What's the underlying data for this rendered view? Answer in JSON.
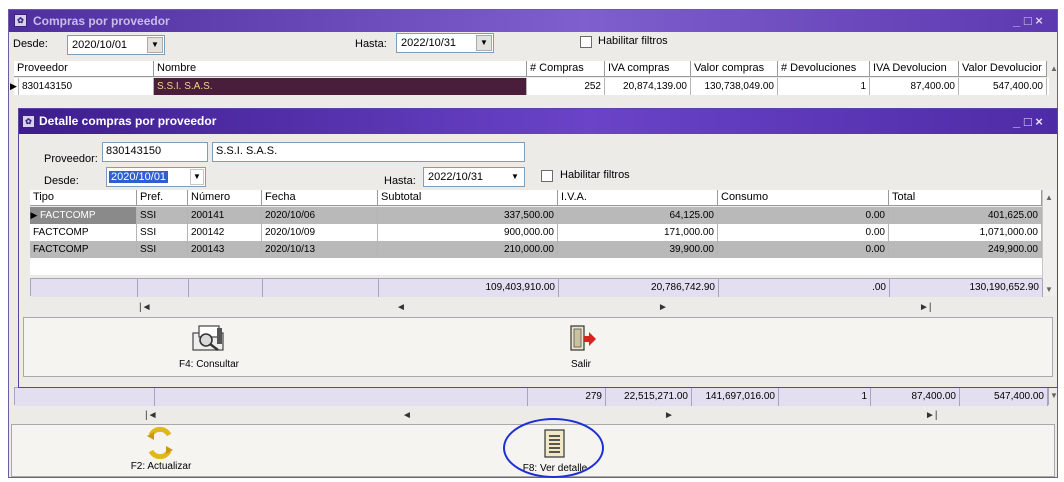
{
  "outer": {
    "title": "Compras por proveedor",
    "window_controls": "_ □ ×",
    "desde_label": "Desde:",
    "desde_value": "2020/10/01",
    "hasta_label": "Hasta:",
    "hasta_value": "2022/10/31",
    "filter_label": "Habilitar filtros",
    "columns": [
      "Proveedor",
      "Nombre",
      "# Compras",
      "IVA compras",
      "Valor compras",
      "# Devoluciones",
      "IVA Devolucion",
      "Valor Devolucior"
    ],
    "row": {
      "proveedor": "830143150",
      "nombre": "S.S.I.  S.A.S.",
      "compras": "252",
      "iva_compras": "20,874,139.00",
      "valor_compras": "130,738,049.00",
      "devoluciones": "1",
      "iva_devolucion": "87,400.00",
      "valor_devolucion": "547,400.00"
    },
    "totals": {
      "compras": "279",
      "iva_compras": "22,515,271.00",
      "valor_compras": "141,697,016.00",
      "devoluciones": "1",
      "iva_devolucion": "87,400.00",
      "valor_devolucion": "547,400.00"
    },
    "btn_actualizar": "F2: Actualizar",
    "btn_ver_detalle": "F8: Ver detalle"
  },
  "detail": {
    "title": "Detalle compras por proveedor",
    "window_controls": "_ □ ×",
    "proveedor_label": "Proveedor:",
    "proveedor_value": "830143150",
    "nombre_value": "S.S.I.  S.A.S.",
    "desde_label": "Desde:",
    "desde_value": "2020/10/01",
    "hasta_label": "Hasta:",
    "hasta_value": "2022/10/31",
    "filter_label": "Habilitar filtros",
    "columns": [
      "Tipo",
      "Pref.",
      "Número",
      "Fecha",
      "Subtotal",
      "I.V.A.",
      "Consumo",
      "Total"
    ],
    "rows": [
      {
        "tipo": "FACTCOMP",
        "pref": "SSI",
        "numero": "200141",
        "fecha": "2020/10/06",
        "subtotal": "337,500.00",
        "iva": "64,125.00",
        "consumo": "0.00",
        "total": "401,625.00"
      },
      {
        "tipo": "FACTCOMP",
        "pref": "SSI",
        "numero": "200142",
        "fecha": "2020/10/09",
        "subtotal": "900,000.00",
        "iva": "171,000.00",
        "consumo": "0.00",
        "total": "1,071,000.00"
      },
      {
        "tipo": "FACTCOMP",
        "pref": "SSI",
        "numero": "200143",
        "fecha": "2020/10/13",
        "subtotal": "210,000.00",
        "iva": "39,900.00",
        "consumo": "0.00",
        "total": "249,900.00"
      }
    ],
    "totals": {
      "subtotal": "109,403,910.00",
      "iva": "20,786,742.90",
      "consumo": ".00",
      "total": "130,190,652.90"
    },
    "btn_consultar": "F4: Consultar",
    "btn_salir": "Salir"
  },
  "nav": {
    "first": "|◄",
    "prev": "◄",
    "next": "►",
    "last": "►|"
  },
  "colors": {
    "title_bar": "#5a35b0",
    "highlight_row": "#4a1d3a",
    "selection": "#2f5fd0",
    "annotation_circle": "#1e2fd6"
  }
}
